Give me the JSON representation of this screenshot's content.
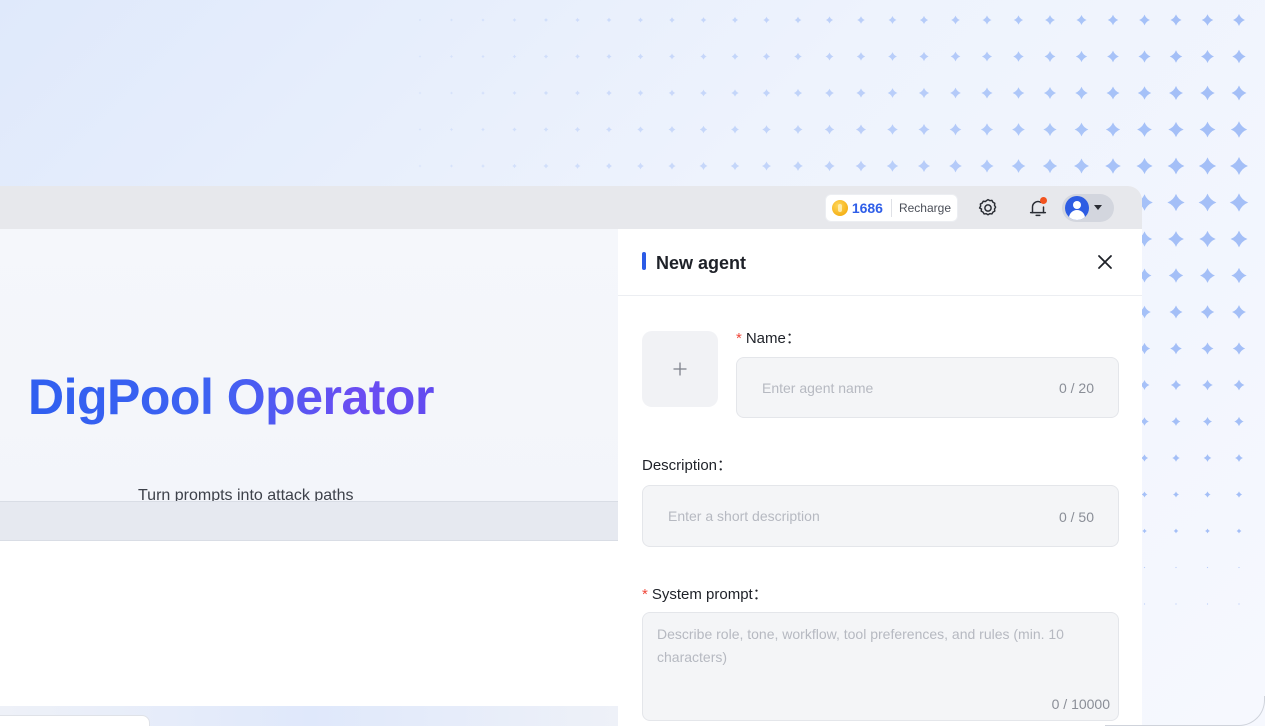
{
  "header": {
    "credits_value": "1686",
    "recharge_label": "Recharge",
    "icons": {
      "coin": "coin-icon",
      "settings": "gear-icon",
      "notifications": "bell-icon",
      "avatar": "user-avatar-icon",
      "dropdown": "caret-down-icon"
    },
    "has_notification": true
  },
  "hero": {
    "title": "DigPool Operator",
    "subtitle": "Turn prompts into attack paths"
  },
  "drawer": {
    "title": "New agent",
    "close_icon": "close-icon",
    "avatar_upload_icon": "plus-icon",
    "name": {
      "label": "Name：",
      "required_mark": "*",
      "placeholder": "Enter agent name",
      "value": "",
      "counter": "0 / 20"
    },
    "description": {
      "label": "Description：",
      "placeholder": "Enter a short description",
      "value": "",
      "counter": "0 / 50"
    },
    "system_prompt": {
      "label": "System prompt：",
      "required_mark": "*",
      "placeholder": "Describe role, tone, workflow, tool preferences, and rules (min. 10 characters)",
      "value": "",
      "counter": "0 / 10000"
    }
  },
  "colors": {
    "accent": "#2c5be6",
    "title_gradient_start": "#2f5ff0",
    "title_gradient_end": "#6b4df2",
    "required": "#f0473a",
    "notification_dot": "#f2531f"
  }
}
